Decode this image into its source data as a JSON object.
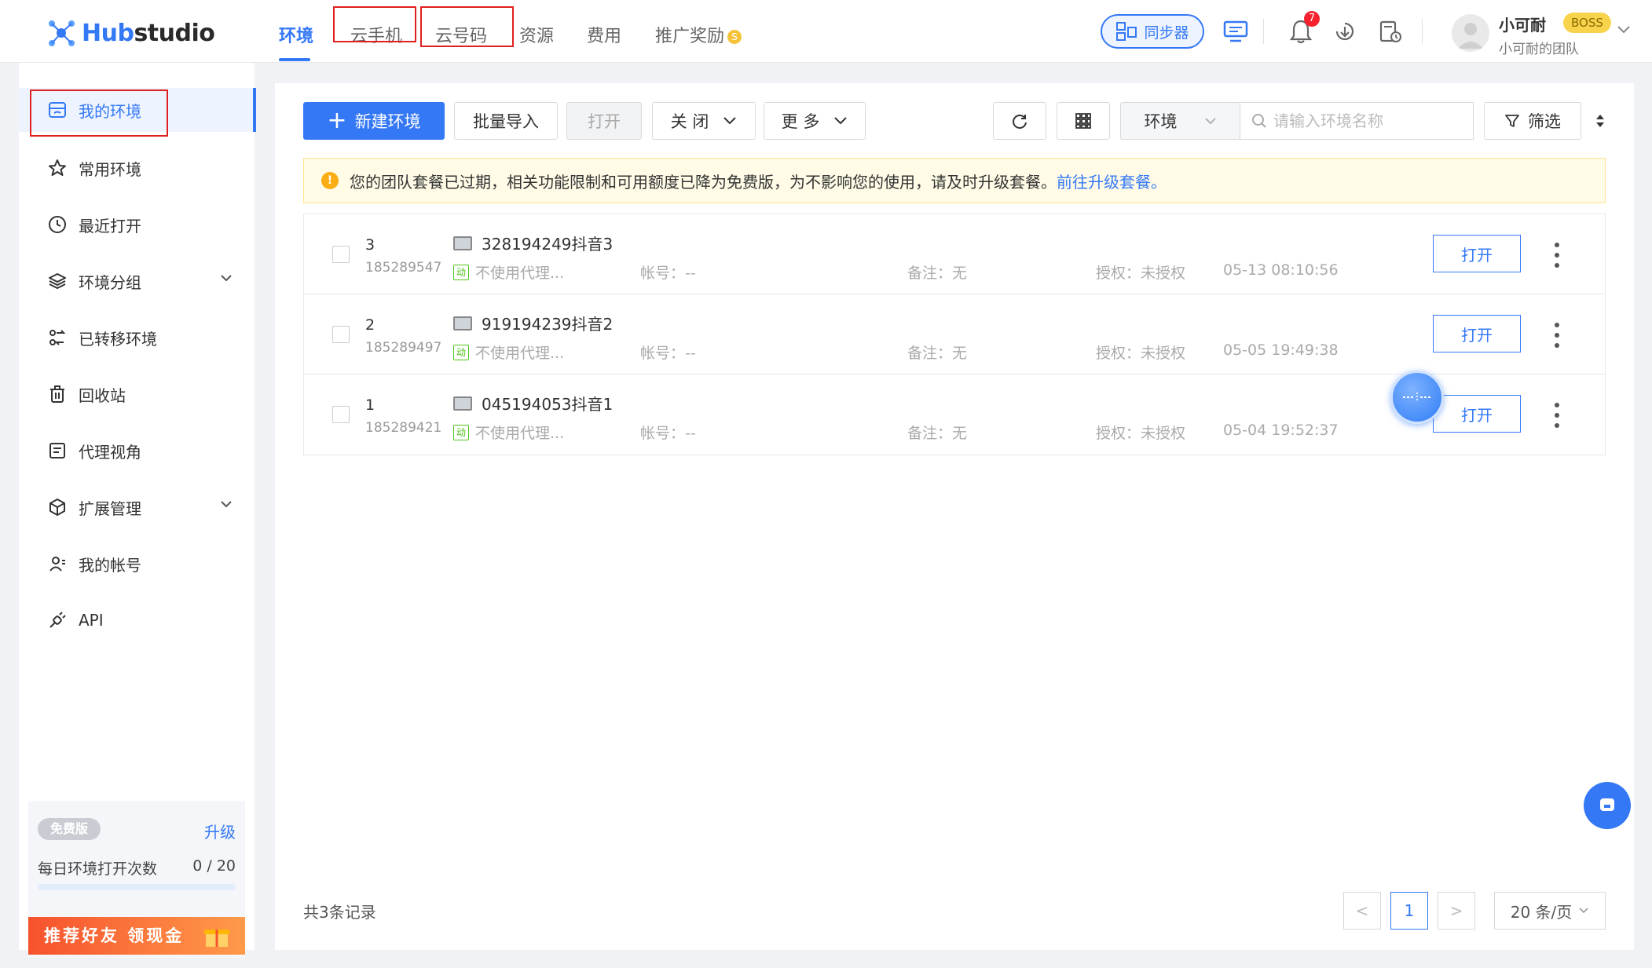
{
  "brand": {
    "name_prefix": "Hub",
    "name_suffix": "studio"
  },
  "nav": {
    "items": [
      {
        "label": "环境",
        "active": true
      },
      {
        "label": "云手机"
      },
      {
        "label": "云号码"
      },
      {
        "label": "资源"
      },
      {
        "label": "费用"
      },
      {
        "label": "推广奖励"
      }
    ],
    "reward_coin": "S"
  },
  "header": {
    "sync_label": "同步器",
    "notification_count": "7",
    "user_name": "小可耐",
    "user_tag": "BOSS",
    "team_name": "小可耐的团队"
  },
  "sidebar": {
    "items": [
      {
        "label": "我的环境",
        "icon": "browser-window-icon",
        "active": true
      },
      {
        "label": "常用环境",
        "icon": "star-icon"
      },
      {
        "label": "最近打开",
        "icon": "clock-icon"
      },
      {
        "label": "环境分组",
        "icon": "layers-icon",
        "expandable": true
      },
      {
        "label": "已转移环境",
        "icon": "transfer-icon"
      },
      {
        "label": "回收站",
        "icon": "trash-icon"
      },
      {
        "label": "代理视角",
        "icon": "proxy-view-icon"
      },
      {
        "label": "扩展管理",
        "icon": "cube-icon",
        "expandable": true
      },
      {
        "label": "我的帐号",
        "icon": "user-icon"
      },
      {
        "label": "API",
        "icon": "plug-icon"
      }
    ],
    "plan": {
      "badge": "免费版",
      "upgrade": "升级",
      "label": "每日环境打开次数",
      "count": "0 / 20",
      "used_fraction": 0
    },
    "promo": "推荐好友 领现金"
  },
  "toolbar": {
    "new_env": "新建环境",
    "batch_import": "批量导入",
    "open": "打开",
    "close": "关 闭",
    "more": "更 多",
    "filter_type": "环境",
    "search_placeholder": "请输入环境名称",
    "filter": "筛选"
  },
  "notice": {
    "text": "您的团队套餐已过期，相关功能限制和可用额度已降为免费版，为不影响您的使用，请及时升级套餐。",
    "link": "前往升级套餐。"
  },
  "table": {
    "rows": [
      {
        "num": "3",
        "id": "185289547",
        "name": "328194249抖音3",
        "proxy": "不使用代理...",
        "proxy_tag": "动",
        "account": "帐号：--",
        "note": "备注：无",
        "auth": "授权：未授权",
        "date": "05-13 08:10:56",
        "open": "打开"
      },
      {
        "num": "2",
        "id": "185289497",
        "name": "919194239抖音2",
        "proxy": "不使用代理...",
        "proxy_tag": "动",
        "account": "帐号：--",
        "note": "备注：无",
        "auth": "授权：未授权",
        "date": "05-05 19:49:38",
        "open": "打开"
      },
      {
        "num": "1",
        "id": "185289421",
        "name": "045194053抖音1",
        "proxy": "不使用代理...",
        "proxy_tag": "动",
        "account": "帐号：--",
        "note": "备注：无",
        "auth": "授权：未授权",
        "date": "05-04 19:52:37",
        "open": "打开"
      }
    ]
  },
  "footer": {
    "total": "共3条记录",
    "page": "1",
    "prev": "<",
    "next": ">",
    "page_size": "20 条/页"
  },
  "colors": {
    "accent": "#3478f6",
    "highlight_box": "#e02020"
  }
}
